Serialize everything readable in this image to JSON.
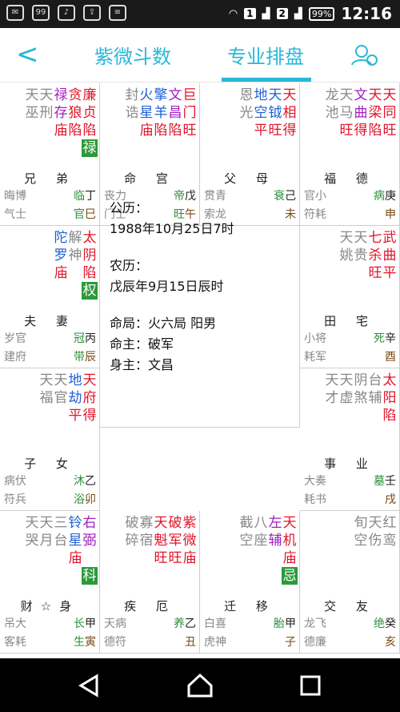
{
  "status_bar": {
    "left_icons": [
      "mail-icon",
      "message-icon",
      "music-icon",
      "upload-icon",
      "chat-icon"
    ],
    "left_badge": "99",
    "sim1": "1",
    "sim2": "2",
    "battery": "99%",
    "time": "12:16"
  },
  "nav": {
    "back_label": "<",
    "tab1": "紫微斗数",
    "tab2": "专业排盘",
    "accent": "#29b8d8"
  },
  "palaces": [
    {
      "name": "兄 弟",
      "stars": [
        [
          "天",
          "巫"
        ],
        [
          "天",
          "刑"
        ],
        [
          "禄",
          "存",
          "庙"
        ],
        [
          "贪",
          "狼",
          "陷"
        ],
        [
          "廉",
          "贞",
          "陷",
          "禄"
        ]
      ],
      "hua_col": 4,
      "b1": "晦博",
      "b2": "气士",
      "s1": "临",
      "s2": "官",
      "d1": "丁",
      "d2": "巳"
    },
    {
      "name": "命 宫",
      "stars": [
        [
          "封",
          "诰"
        ],
        [
          "火",
          "星",
          "庙"
        ],
        [
          "擎",
          "羊",
          "陷"
        ],
        [
          "文",
          "昌",
          "陷"
        ],
        [
          "巨",
          "门",
          "旺"
        ]
      ],
      "b1": "丧力",
      "b2": "门士",
      "s1": "帝",
      "s2": "旺",
      "d1": "戊",
      "d2": "午"
    },
    {
      "name": "父 母",
      "stars": [
        [
          "恩",
          "光"
        ],
        [
          "地",
          "空",
          "平"
        ],
        [
          "天",
          "钺",
          "旺"
        ],
        [
          "天",
          "相",
          "得"
        ]
      ],
      "b1": "贯青",
      "b2": "索龙",
      "s1": "衰",
      "s2": "",
      "d1": "己",
      "d2": "未"
    },
    {
      "name": "福 德",
      "stars": [
        [
          "龙",
          "池"
        ],
        [
          "天",
          "马",
          "旺"
        ],
        [
          "文",
          "曲",
          "得"
        ],
        [
          "天",
          "梁",
          "陷"
        ],
        [
          "天",
          "同",
          "旺"
        ]
      ],
      "b1": "官小",
      "b2": "符耗",
      "s1": "病",
      "s2": "",
      "d1": "庚",
      "d2": "申"
    },
    {
      "name": "田 宅",
      "stars": [
        [
          "天",
          "姚"
        ],
        [
          "天",
          "贵"
        ],
        [
          "七",
          "杀",
          "旺"
        ],
        [
          "武",
          "曲",
          "平"
        ]
      ],
      "b1": "小将",
      "b2": "耗军",
      "s1": "死",
      "s2": "",
      "d1": "辛",
      "d2": "酉"
    },
    {
      "name": "事 业",
      "stars": [
        [
          "天",
          "才"
        ],
        [
          "天",
          "虚"
        ],
        [
          "阴",
          "煞"
        ],
        [
          "台",
          "辅"
        ],
        [
          "太",
          "阳",
          "陷"
        ]
      ],
      "b1": "大奏",
      "b2": "耗书",
      "s1": "墓",
      "s2": "",
      "d1": "壬",
      "d2": "戌"
    },
    {
      "name": "交 友",
      "stars": [
        [
          "旬",
          "空"
        ],
        [
          "天",
          "伤"
        ],
        [
          "红",
          "鸾"
        ]
      ],
      "b1": "龙飞",
      "b2": "德廉",
      "s1": "绝",
      "s2": "",
      "d1": "癸",
      "d2": "亥"
    },
    {
      "name": "迁 移",
      "stars": [
        [
          "截",
          "空"
        ],
        [
          "八",
          "座"
        ],
        [
          "左",
          "辅"
        ],
        [
          "天",
          "机",
          "庙",
          "忌"
        ]
      ],
      "hua_col": 3,
      "b1": "白喜",
      "b2": "虎神",
      "s1": "胎",
      "s2": "",
      "d1": "甲",
      "d2": "子"
    },
    {
      "name": "疾 厄",
      "stars": [
        [
          "破",
          "碎"
        ],
        [
          "寡",
          "宿"
        ],
        [
          "天",
          "魁",
          "旺"
        ],
        [
          "破",
          "军",
          "旺"
        ],
        [
          "紫",
          "微",
          "庙"
        ]
      ],
      "b1": "天病",
      "b2": "德符",
      "s1": "养",
      "s2": "",
      "d1": "乙",
      "d2": "丑"
    },
    {
      "name": "财☆身",
      "stars": [
        [
          "天",
          "哭"
        ],
        [
          "天",
          "月"
        ],
        [
          "三",
          "台"
        ],
        [
          "铃",
          "星",
          "庙"
        ],
        [
          "右",
          "弼",
          "",
          "科"
        ]
      ],
      "hua_col": 4,
      "b1": "吊大",
      "b2": "客耗",
      "s1": "长",
      "s2": "生",
      "d1": "甲",
      "d2": "寅"
    },
    {
      "name": "子 女",
      "stars": [
        [
          "天",
          "福"
        ],
        [
          "天",
          "官"
        ],
        [
          "地",
          "劫",
          "平"
        ],
        [
          "天",
          "府",
          "得"
        ]
      ],
      "b1": "病伏",
      "b2": "符兵",
      "s1": "沐",
      "s2": "浴",
      "d1": "乙",
      "d2": "卯"
    },
    {
      "name": "夫 妻",
      "stars": [
        [
          "陀",
          "罗",
          "庙"
        ],
        [
          "解",
          "神"
        ],
        [
          "太",
          "阴",
          "陷",
          "权"
        ]
      ],
      "hua_col": 2,
      "b1": "岁官",
      "b2": "建府",
      "s1": "冠",
      "s2": "带",
      "d1": "丙",
      "d2": "辰"
    }
  ],
  "center": {
    "gongli_label": "公历：",
    "gongli_value": "1988年10月25日7时",
    "nongli_label": "农历：",
    "nongli_value": "戊辰年9月15日辰时",
    "mingju": "命局：火六局 阳男",
    "mingzhu": "命主：破军",
    "shenzhu": "身主：文昌"
  },
  "colors": {
    "red": "#e0142a",
    "blue": "#1f5fd4",
    "purple": "#a020c0",
    "green": "#2b8f37",
    "gray": "#888888",
    "brown": "#7a4a10"
  }
}
